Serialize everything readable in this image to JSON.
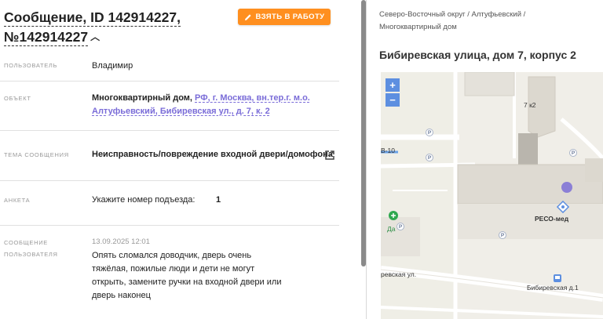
{
  "message": {
    "title_line1": "Сообщение, ID 142914227,",
    "title_line2": "№142914227",
    "take_button": "ВЗЯТЬ В РАБОТУ"
  },
  "fields": {
    "user_label": "ПОЛЬЗОВАТЕЛЬ",
    "user_value": "Владимир",
    "object_label": "ОБЪЕКТ",
    "object_type": "Многоквартирный дом,",
    "object_link_line1": "РФ, г. Москва, вн.тер.г. м.о.",
    "object_link_line2": "Алтуфьевский, Бибиревская ул., д. 7, к. 2",
    "topic_label": "ТЕМА СООБЩЕНИЯ",
    "topic_value": "Неисправность/повреждение входной двери/домофона",
    "survey_label": "АНКЕТА",
    "survey_question": "Укажите номер подъезда:",
    "survey_answer": "1",
    "msg_label_line1": "СООБЩЕНИЕ",
    "msg_label_line2": "ПОЛЬЗОВАТЕЛЯ",
    "msg_date": "13.09.2025 12:01",
    "msg_text_line1": "Опять сломался доводчик, дверь очень",
    "msg_text_line2": "тяжёлая, пожилые люди и дети не могут",
    "msg_text_line3": "открыть, замените ручки на входной двери или",
    "msg_text_line4": "дверь наконец"
  },
  "location": {
    "breadcrumb_line1": "Северо-Восточный округ / Алтуфьевский /",
    "breadcrumb_line2": "Многоквартирный дом",
    "address": "Бибиревская улица, дом 7, корпус 2"
  },
  "map": {
    "zoom_in": "+",
    "zoom_out": "−",
    "building_label": "7 к2",
    "label_b10": "В-10",
    "label_reso": "РЕСО-мед",
    "label_da": "Да",
    "label_street": "ревская ул.",
    "label_bibirevskaya": "Бибиревская д.1",
    "parking_symbol": "P",
    "accent_color": "#ff8f1f",
    "link_color": "#7a6cd8",
    "zoom_color": "#5d8fe0",
    "marker_color": "#8b7fd6"
  }
}
